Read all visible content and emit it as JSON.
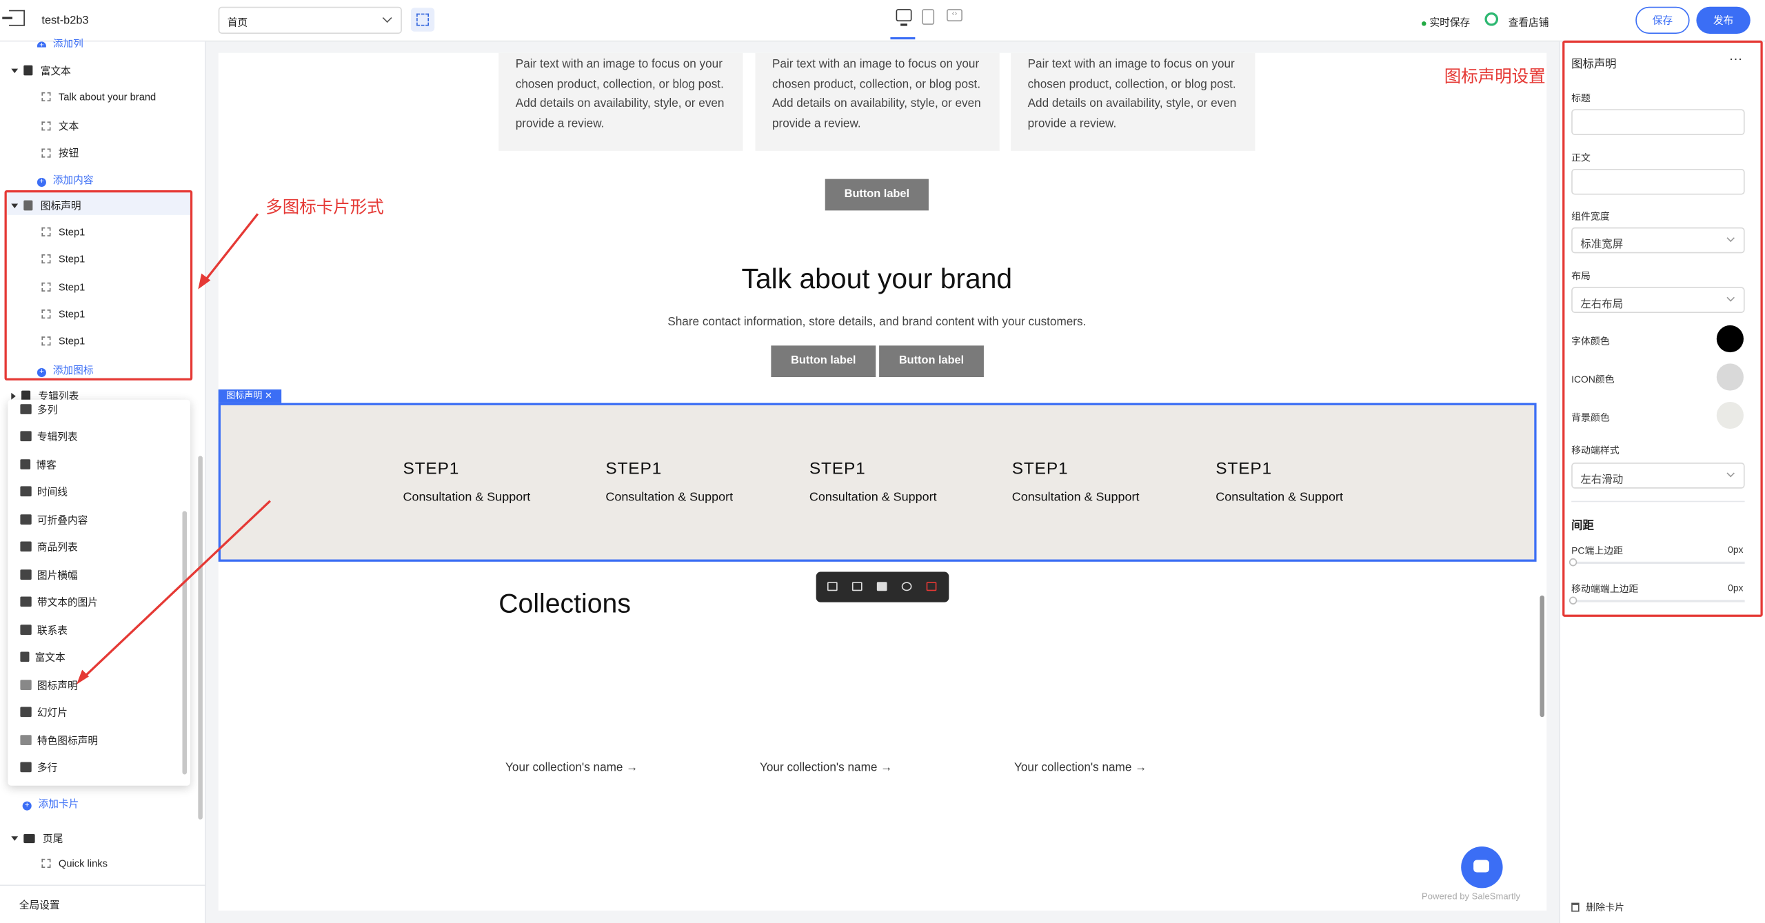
{
  "topbar": {
    "store_name": "test-b2b3",
    "page_select": "首页",
    "live_save": "实时保存",
    "view_store": "查看店铺",
    "save": "保存",
    "publish": "发布"
  },
  "sidebar": {
    "add_column_partial": "添加列",
    "rich_text": "富文本",
    "rich_items": [
      "Talk about your brand",
      "文本",
      "按钮"
    ],
    "add_content": "添加内容",
    "icon_statement": "图标声明",
    "icon_items": [
      "Step1",
      "Step1",
      "Step1",
      "Step1",
      "Step1"
    ],
    "add_icon": "添加图标",
    "album_list": "专辑列表",
    "add_card": "添加卡片",
    "footer": "页尾",
    "footer_items": [
      "Quick links"
    ],
    "global_settings": "全局设置"
  },
  "menu": {
    "items": [
      "多列",
      "专辑列表",
      "博客",
      "时间线",
      "可折叠内容",
      "商品列表",
      "图片横幅",
      "带文本的图片",
      "联系表",
      "富文本",
      "图标声明",
      "幻灯片",
      "特色图标声明",
      "多行"
    ]
  },
  "annotations": {
    "left": "多图标卡片形式",
    "right": "图标声明设置"
  },
  "canvas": {
    "card_text": "Pair text with an image to focus on your chosen product, collection, or blog post. Add details on availability, style, or even provide a review.",
    "button_label": "Button label",
    "brand_title": "Talk about your brand",
    "brand_sub": "Share contact information, store details, and brand content with your customers.",
    "section_tag": "图标声明",
    "steps": [
      {
        "title": "STEP1",
        "desc": "Consultation & Support"
      },
      {
        "title": "STEP1",
        "desc": "Consultation & Support"
      },
      {
        "title": "STEP1",
        "desc": "Consultation & Support"
      },
      {
        "title": "STEP1",
        "desc": "Consultation & Support"
      },
      {
        "title": "STEP1",
        "desc": "Consultation & Support"
      }
    ],
    "collections_title": "Collections",
    "collection_link": "Your collection's name →",
    "powered": "Powered by SaleSmartly"
  },
  "settings": {
    "title": "图标声明",
    "more": "···",
    "heading_label": "标题",
    "body_label": "正文",
    "width_label": "组件宽度",
    "width_value": "标准宽屏",
    "layout_label": "布局",
    "layout_value": "左右布局",
    "font_color_label": "字体颜色",
    "icon_color_label": "ICON颜色",
    "bg_color_label": "背景颜色",
    "mobile_style_label": "移动端样式",
    "mobile_style_value": "左右滑动",
    "spacing": "间距",
    "pc_top_label": "PC端上边距",
    "pc_top_value": "0px",
    "mobile_top_label": "移动端端上边距",
    "mobile_top_value": "0px",
    "delete_card": "删除卡片",
    "colors": {
      "font": "#000000",
      "icon": "#d9d9d9",
      "bg": "#eaeae6"
    }
  }
}
